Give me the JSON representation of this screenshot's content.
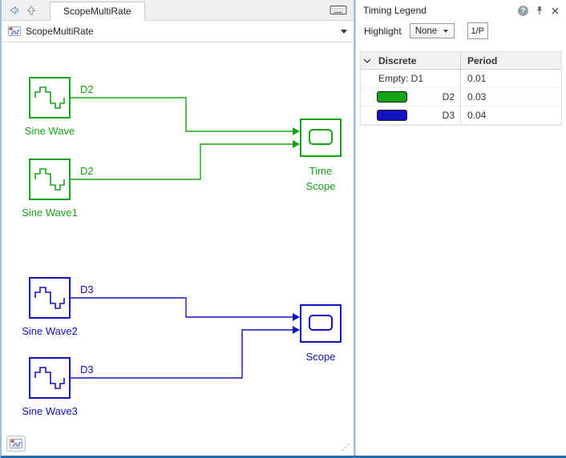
{
  "editor": {
    "tab_label": "ScopeMultiRate",
    "breadcrumb": "ScopeMultiRate"
  },
  "canvas": {
    "colors": {
      "d2": "#16a316",
      "d3": "#1111bf"
    },
    "blocks": {
      "sine_wave": {
        "label": "Sine Wave",
        "rate": "D2"
      },
      "sine_wave1": {
        "label": "Sine Wave1",
        "rate": "D2"
      },
      "sine_wave2": {
        "label": "Sine Wave2",
        "rate": "D3"
      },
      "sine_wave3": {
        "label": "Sine Wave3",
        "rate": "D3"
      },
      "time_scope": {
        "label_line1": "Time",
        "label_line2": "Scope"
      },
      "scope": {
        "label": "Scope"
      }
    }
  },
  "legend": {
    "title": "Timing Legend",
    "highlight_label": "Highlight",
    "highlight_value": "None",
    "period_button_label": "1/P",
    "table": {
      "columns": [
        "Discrete",
        "Period"
      ],
      "rows": [
        {
          "label": "Empty: D1",
          "period": "0.01"
        },
        {
          "label": "D2",
          "period": "0.03",
          "swatch": "#16a316"
        },
        {
          "label": "D3",
          "period": "0.04",
          "swatch": "#1111bf"
        }
      ]
    }
  }
}
